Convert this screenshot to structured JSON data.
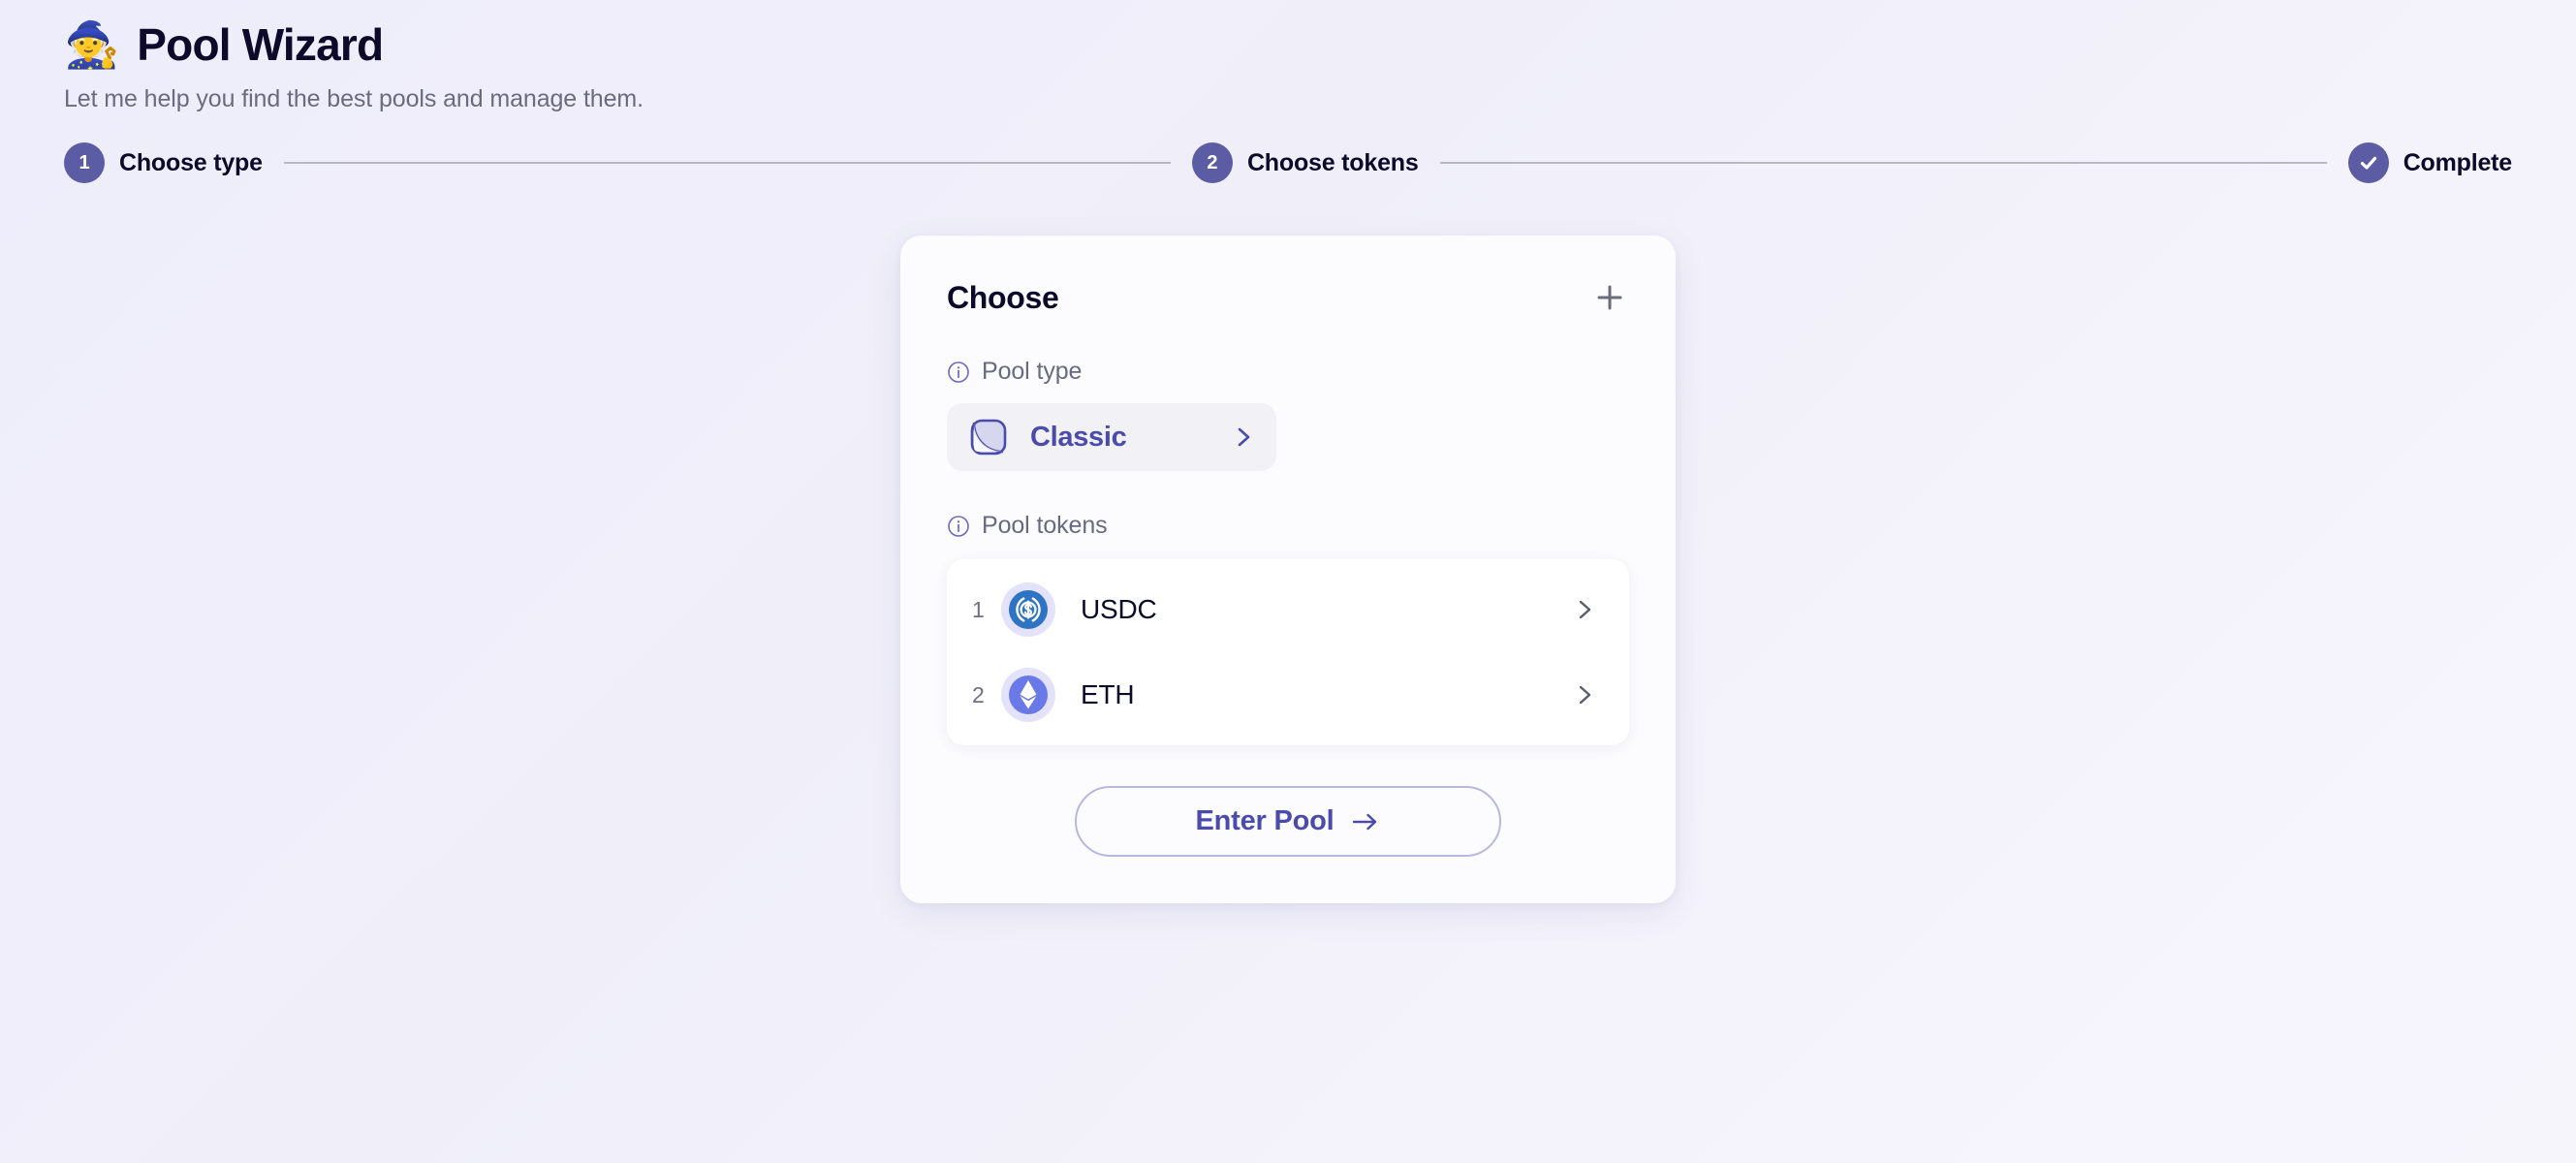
{
  "header": {
    "emoji": "🧙",
    "emoji_icon_name": "wizard-emoji",
    "title": "Pool Wizard",
    "subtitle": "Let me help you find the best pools and manage them."
  },
  "stepper": {
    "steps": [
      {
        "indicator": "1",
        "label": "Choose type",
        "state": "active",
        "icon": "number-badge"
      },
      {
        "indicator": "2",
        "label": "Choose tokens",
        "state": "active",
        "icon": "number-badge"
      },
      {
        "indicator": "✔",
        "label": "Complete",
        "state": "complete",
        "icon": "check-icon"
      }
    ]
  },
  "card": {
    "title": "Choose",
    "add_icon": "plus-icon",
    "pool_type": {
      "label": "Pool type",
      "info_icon": "info-icon",
      "selected": "Classic",
      "type_icon": "classic-pool-icon",
      "chevron_icon": "chevron-right-icon"
    },
    "pool_tokens": {
      "label": "Pool tokens",
      "info_icon": "info-icon",
      "tokens": [
        {
          "index": "1",
          "symbol": "USDC",
          "icon": "usdc-token-icon",
          "chevron_icon": "chevron-right-icon"
        },
        {
          "index": "2",
          "symbol": "ETH",
          "icon": "eth-token-icon",
          "chevron_icon": "chevron-right-icon"
        }
      ]
    },
    "primary_action": {
      "label": "Enter Pool",
      "arrow_icon": "arrow-right-icon"
    }
  },
  "colors": {
    "accent_indigo": "#4b4bad",
    "step_circle": "#5c5ca4",
    "page_background": "#f0eff9",
    "card_background": "#fcfcfe",
    "usdc_blue": "#2e74c4",
    "eth_indigo": "#6979e8",
    "muted_text": "#696982",
    "title_text": "#0b0a2a"
  }
}
